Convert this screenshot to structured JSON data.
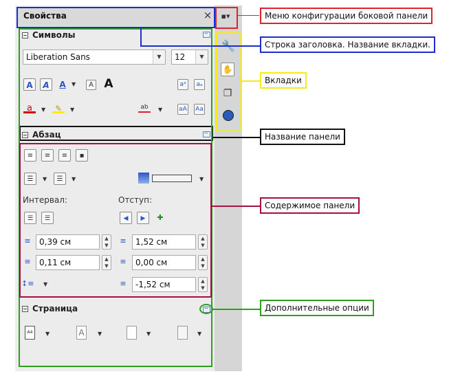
{
  "sidebar": {
    "title": "Свойства",
    "close_symbol": "×",
    "menu_symbol": "▪▾"
  },
  "panels": {
    "symbols": {
      "title": "Символы",
      "font_name": "Liberation Sans",
      "font_size": "12"
    },
    "paragraph": {
      "title": "Абзац",
      "spacing_label": "Интервал:",
      "indent_label": "Отступ:",
      "above_spacing": "0,39 см",
      "below_spacing": "0,11 см",
      "before_indent": "1,52 см",
      "after_indent": "0,00 см",
      "first_line_indent": "-1,52 см"
    },
    "page": {
      "title": "Страница"
    }
  },
  "tabs": [
    {
      "icon": "wrench-icon"
    },
    {
      "icon": "styles-icon"
    },
    {
      "icon": "gallery-icon"
    },
    {
      "icon": "navigator-icon"
    }
  ],
  "callouts": {
    "config_menu": "Меню конфигурации боковой панели",
    "title_bar": "Строка заголовка. Название вкладки.",
    "tabs": "Вкладки",
    "panel_title": "Название панели",
    "panel_content": "Содержимое панели",
    "more_options": "Дополнительные опции"
  },
  "colors": {
    "red": "#d9232e",
    "blue": "#1d2bd1",
    "yellow": "#f6ea1c",
    "green": "#2f9e1f",
    "black": "#111111",
    "crimson": "#a3123e"
  }
}
